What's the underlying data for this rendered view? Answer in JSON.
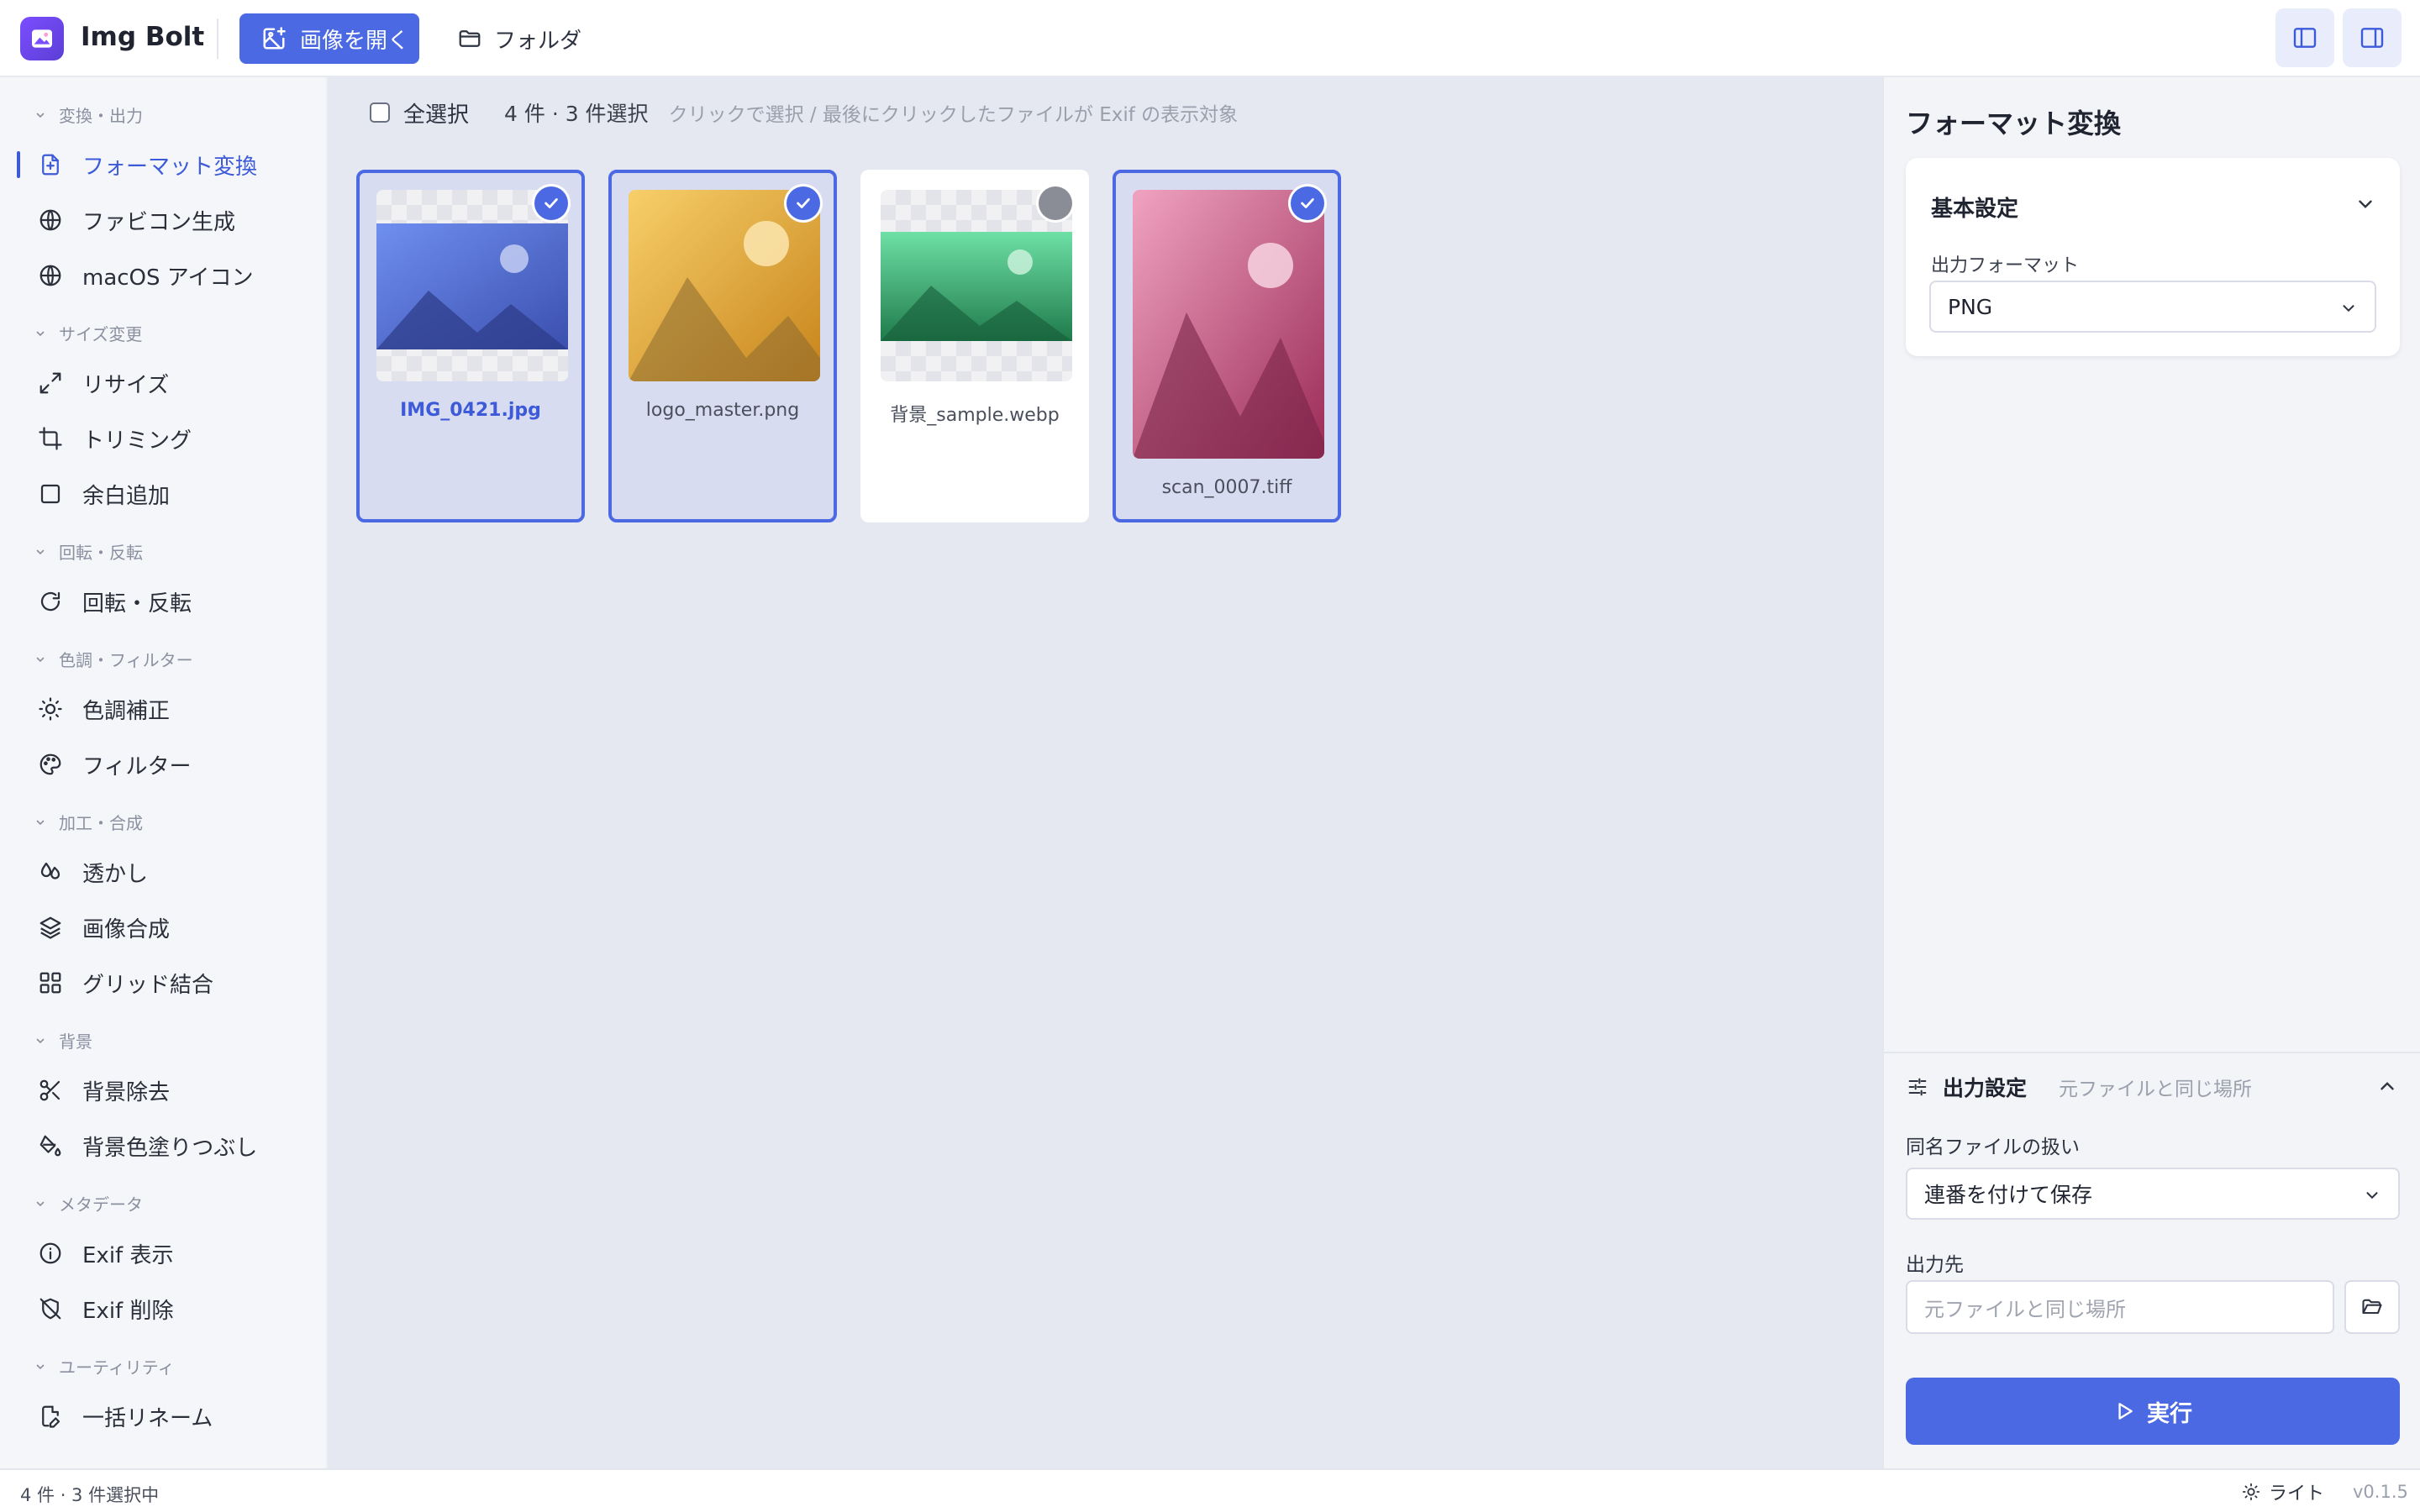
{
  "app": {
    "name": "Img Bolt"
  },
  "toolbar": {
    "open_label": "画像を開く",
    "folder_label": "フォルダ"
  },
  "sidebar": {
    "sections": [
      {
        "label": "変換・出力",
        "items": [
          {
            "label": "フォーマット変換",
            "icon": "file-convert-icon",
            "active": true
          },
          {
            "label": "ファビコン生成",
            "icon": "globe-icon"
          },
          {
            "label": "macOS アイコン",
            "icon": "globe-icon"
          }
        ]
      },
      {
        "label": "サイズ変更",
        "items": [
          {
            "label": "リサイズ",
            "icon": "resize-arrows-icon"
          },
          {
            "label": "トリミング",
            "icon": "crop-icon"
          },
          {
            "label": "余白追加",
            "icon": "square-icon"
          }
        ]
      },
      {
        "label": "回転・反転",
        "items": [
          {
            "label": "回転・反転",
            "icon": "rotate-icon"
          }
        ]
      },
      {
        "label": "色調・フィルター",
        "items": [
          {
            "label": "色調補正",
            "icon": "sun-icon"
          },
          {
            "label": "フィルター",
            "icon": "palette-icon"
          }
        ]
      },
      {
        "label": "加工・合成",
        "items": [
          {
            "label": "透かし",
            "icon": "droplets-icon"
          },
          {
            "label": "画像合成",
            "icon": "layers-icon"
          },
          {
            "label": "グリッド結合",
            "icon": "grid-icon"
          }
        ]
      },
      {
        "label": "背景",
        "items": [
          {
            "label": "背景除去",
            "icon": "scissors-icon"
          },
          {
            "label": "背景色塗りつぶし",
            "icon": "paint-bucket-icon"
          }
        ]
      },
      {
        "label": "メタデータ",
        "items": [
          {
            "label": "Exif 表示",
            "icon": "info-icon"
          },
          {
            "label": "Exif 削除",
            "icon": "shield-off-icon"
          }
        ]
      },
      {
        "label": "ユーティリティ",
        "items": [
          {
            "label": "一括リネーム",
            "icon": "file-edit-icon"
          }
        ]
      }
    ]
  },
  "selection": {
    "select_all_label": "全選択",
    "count_text": "4 件 · 3 件選択",
    "hint": "クリックで選択 / 最後にクリックしたファイルが Exif の表示対象"
  },
  "files": [
    {
      "name": "IMG_0421.jpg",
      "selected": true,
      "primary": true,
      "colors": [
        "#6f8ff0",
        "#3b4fae"
      ]
    },
    {
      "name": "logo_master.png",
      "selected": true,
      "primary": false,
      "colors": [
        "#f2c35e",
        "#c8841b"
      ]
    },
    {
      "name": "背景_sample.webp",
      "selected": false,
      "primary": false,
      "colors": [
        "#5fd39a",
        "#1f7a4b"
      ]
    },
    {
      "name": "scan_0007.tiff",
      "selected": true,
      "primary": false,
      "colors": [
        "#ec9ab8",
        "#9b2c58"
      ]
    }
  ],
  "right_panel": {
    "title": "フォーマット変換",
    "basic_settings": {
      "title": "基本設定",
      "output_format_label": "出力フォーマット",
      "output_format_value": "PNG"
    },
    "output_settings": {
      "title": "出力設定",
      "subtitle": "元ファイルと同じ場所",
      "same_name_label": "同名ファイルの扱い",
      "same_name_value": "連番を付けて保存",
      "destination_label": "出力先",
      "destination_placeholder": "元ファイルと同じ場所"
    },
    "run_label": "実行"
  },
  "statusbar": {
    "left": "4 件 · 3 件選択中",
    "theme_label": "ライト",
    "version": "v0.1.5"
  },
  "colors": {
    "accent": "#4a69e2",
    "sidebar_bg": "#f5f6f9",
    "main_bg": "#e6e8f1"
  }
}
